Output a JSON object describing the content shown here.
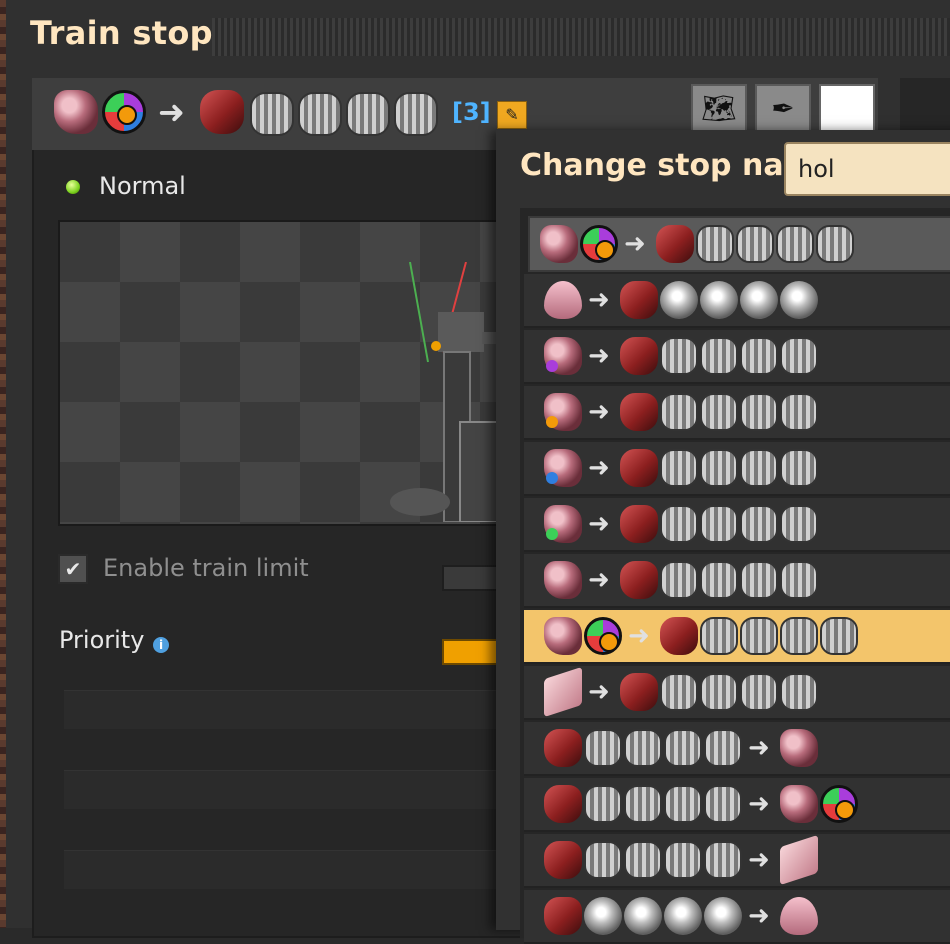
{
  "window": {
    "title": "Train stop"
  },
  "station": {
    "count_label": "[3]",
    "icons": [
      "rock-icon",
      "flower-icon",
      "arrow-right-icon",
      "locomotive-icon",
      "wagon-icon",
      "wagon-icon",
      "wagon-icon",
      "wagon-icon"
    ]
  },
  "toolbar": {
    "pencil_symbol": "✎",
    "map_symbol": "🗺",
    "picker_symbol": "✒",
    "color_swatch": "#ffffff"
  },
  "status": {
    "text": "Normal",
    "color": "#7cd21f"
  },
  "train_limit": {
    "label": "Enable train limit",
    "checked": true,
    "check_symbol": "✔"
  },
  "priority": {
    "label": "Priority",
    "info_symbol": "i"
  },
  "colors": {
    "accent": "#f0a000",
    "selected_row": "#f3c56b",
    "count_blue": "#4fb4ff"
  },
  "popup": {
    "title": "Change stop nan",
    "input_value": "hol",
    "rows": [
      {
        "icons": [
          "rock",
          "flower",
          "arrow",
          "loco",
          "wagon",
          "wagon",
          "wagon",
          "wagon"
        ],
        "style": "top"
      },
      {
        "icons": [
          "drop",
          "arrow",
          "loco",
          "tank",
          "tank",
          "tank",
          "tank"
        ],
        "style": ""
      },
      {
        "icons": [
          "rock",
          "arrow",
          "loco",
          "wagon",
          "wagon",
          "wagon",
          "wagon"
        ],
        "style": "",
        "badge": "#a93ddb"
      },
      {
        "icons": [
          "rock",
          "arrow",
          "loco",
          "wagon",
          "wagon",
          "wagon",
          "wagon"
        ],
        "style": "",
        "badge": "#f39a0a"
      },
      {
        "icons": [
          "rock",
          "arrow",
          "loco",
          "wagon",
          "wagon",
          "wagon",
          "wagon"
        ],
        "style": "",
        "badge": "#2f7fe0"
      },
      {
        "icons": [
          "rock",
          "arrow",
          "loco",
          "wagon",
          "wagon",
          "wagon",
          "wagon"
        ],
        "style": "",
        "badge": "#3ccf58"
      },
      {
        "icons": [
          "rock",
          "arrow",
          "loco",
          "wagon",
          "wagon",
          "wagon",
          "wagon"
        ],
        "style": ""
      },
      {
        "icons": [
          "rock",
          "flower",
          "arrow",
          "loco",
          "wagon",
          "wagon",
          "wagon",
          "wagon"
        ],
        "style": "sel"
      },
      {
        "icons": [
          "plate",
          "arrow",
          "loco",
          "wagon",
          "wagon",
          "wagon",
          "wagon"
        ],
        "style": ""
      },
      {
        "icons": [
          "loco",
          "wagon",
          "wagon",
          "wagon",
          "wagon",
          "arrow",
          "rock"
        ],
        "style": ""
      },
      {
        "icons": [
          "loco",
          "wagon",
          "wagon",
          "wagon",
          "wagon",
          "arrow",
          "rock",
          "flower"
        ],
        "style": ""
      },
      {
        "icons": [
          "loco",
          "wagon",
          "wagon",
          "wagon",
          "wagon",
          "arrow",
          "plate"
        ],
        "style": ""
      },
      {
        "icons": [
          "loco",
          "tank",
          "tank",
          "tank",
          "tank",
          "arrow",
          "drop"
        ],
        "style": ""
      }
    ]
  }
}
